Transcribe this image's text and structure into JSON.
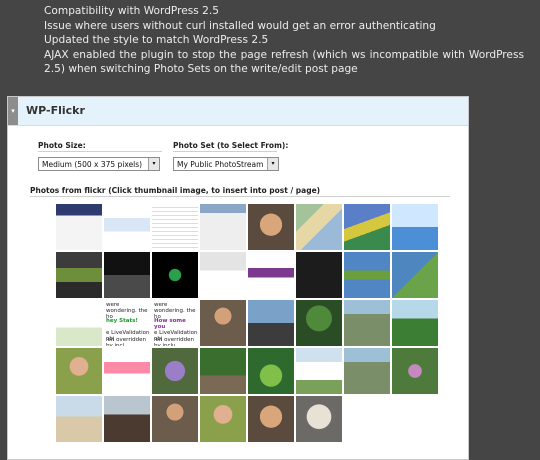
{
  "changelog": [
    "Compatibility with WordPress 2.5",
    "Issue where users without curl installed would get an error authenticating",
    "Updated the style to match WordPress 2.5",
    "AJAX enabled the plugin to stop the page refresh (which ws incompatible with WordPress 2.5) when switching Photo Sets on the write/edit post page"
  ],
  "panel": {
    "title": "WP-Flickr",
    "photo_size_label": "Photo Size:",
    "photo_size_value": "Medium (500 x 375 pixels)",
    "photo_set_label": "Photo Set (to Select From):",
    "photo_set_value": "My Public PhotoStream",
    "photos_label": "Photos from flickr (Click thumbnail image, to insert into post / page)"
  },
  "thumb_text": {
    "t31_line1": "were wondering. the ho",
    "t31_line2": "hey Stats!",
    "t31_line3": "e LiveValidation obj",
    "t31_line4": "ien overridden by incl",
    "t32_line1": "were wondering. the ho",
    "t32_line2": "How some you",
    "t32_line3": "e LiveValidation obj",
    "t32_line4": "ien overridden by inclu"
  }
}
